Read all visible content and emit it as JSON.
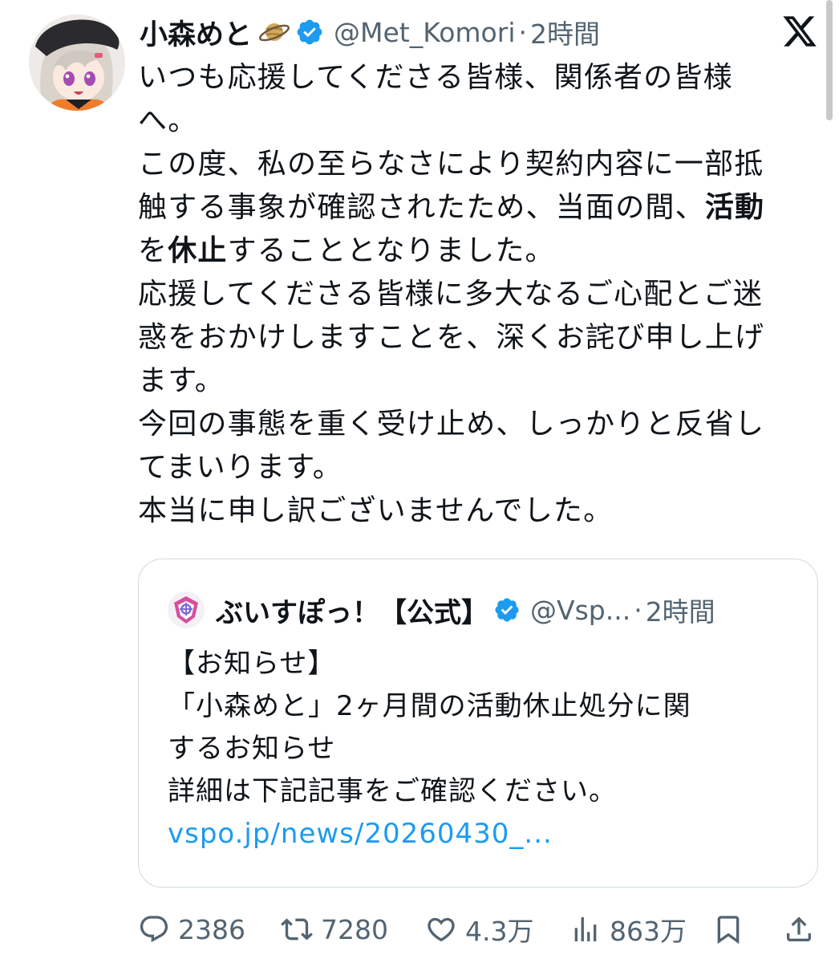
{
  "post": {
    "author": {
      "display_name": "小森めと",
      "handle": "@Met_Komori",
      "separator": "·",
      "time": "2時間",
      "badge_icon": "ringed-planet-emoji",
      "verified": true
    },
    "body_lines": [
      {
        "parts": [
          {
            "text": "いつも応援してくださる皆様、関係者の皆様",
            "bold": false
          }
        ]
      },
      {
        "parts": [
          {
            "text": "へ。",
            "bold": false
          }
        ]
      },
      {
        "parts": [
          {
            "text": "この度、私の至らなさにより契約内容に一部抵",
            "bold": false
          }
        ]
      },
      {
        "parts": [
          {
            "text": "触する事象が確認されたため、当面の間、",
            "bold": false
          },
          {
            "text": "活動",
            "bold": true
          }
        ]
      },
      {
        "parts": [
          {
            "text": "を",
            "bold": false
          },
          {
            "text": "休止",
            "bold": true
          },
          {
            "text": "することとなりました。",
            "bold": false
          }
        ]
      },
      {
        "parts": [
          {
            "text": "応援してくださる皆様に多大なるご心配とご迷",
            "bold": false
          }
        ]
      },
      {
        "parts": [
          {
            "text": "惑をおかけしますことを、深くお詫び申し上げ",
            "bold": false
          }
        ]
      },
      {
        "parts": [
          {
            "text": "ます。",
            "bold": false
          }
        ]
      },
      {
        "parts": [
          {
            "text": "今回の事態を重く受け止め、しっかりと反省し",
            "bold": false
          }
        ]
      },
      {
        "parts": [
          {
            "text": "てまいります。",
            "bold": false
          }
        ]
      },
      {
        "parts": [
          {
            "text": "本当に申し訳ございませんでした。",
            "bold": false
          }
        ]
      }
    ],
    "quote": {
      "display_name": "ぶいすぽっ！【公式】",
      "handle": "@Vsp...",
      "separator": "·",
      "time": "2時間",
      "verified": true,
      "lines": [
        "【お知らせ】",
        "「小森めと」2ヶ月間の活動休止処分に関",
        "するお知らせ",
        "詳細は下記記事をご確認ください。"
      ],
      "link": "vspo.jp/news/20260430_..."
    },
    "actions": {
      "replies": "2386",
      "reposts": "7280",
      "likes": "4.3万",
      "views": "863万"
    },
    "colors": {
      "verified": "#1d9bf0",
      "link": "#1d9bf0",
      "secondary_text": "#536471",
      "border": "#cfd9de"
    },
    "icons": {
      "logo": "x-logo-icon",
      "reply": "reply-icon",
      "repost": "repost-icon",
      "like": "heart-icon",
      "views": "views-icon",
      "bookmark": "bookmark-icon",
      "share": "share-icon"
    }
  }
}
